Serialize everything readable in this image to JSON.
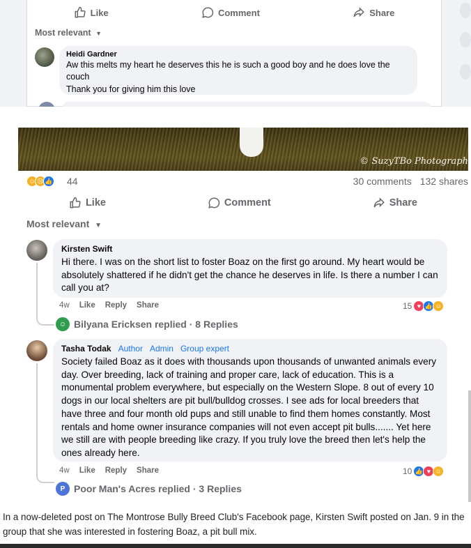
{
  "top_card": {
    "actions": {
      "like": "Like",
      "comment": "Comment",
      "share": "Share"
    },
    "sort_label": "Most relevant",
    "comment": {
      "author": "Heidi Gardner",
      "text": "Aw this melts my heart he deserves this he is such a good boy and he does love the couch",
      "text2": "Thank you for giving him this love"
    }
  },
  "post": {
    "photo_credit": "© SuzyTBo Photograph",
    "reaction_count": "44",
    "comments_count": "30 comments",
    "shares_count": "132 shares",
    "actions": {
      "like": "Like",
      "comment": "Comment",
      "share": "Share"
    },
    "sort_label": "Most relevant"
  },
  "comments": [
    {
      "author": "Kirsten Swift",
      "text": "Hi there. I was on the short list to foster Boaz on the first go around. My heart would be absolutely shattered if he didn't get the chance he deserves in life. Is there a number I can call you at?",
      "time": "4w",
      "like": "Like",
      "reply": "Reply",
      "share": "Share",
      "reactions": "15",
      "replied_by": "Bilyana Ericksen replied · 8 Replies"
    },
    {
      "author": "Tasha Todak",
      "badges": [
        "Author",
        "Admin",
        "Group expert"
      ],
      "text": "Society failed Boaz as it does with thousands upon thousands of unwanted animals every day. Over breeding, lack of training and proper care, lack of education. This is a monumental problem everywhere, but especially on the Western Slope. 8 out of every 10 dogs in our local shelters are pit bull/bulldog crosses. I see ads for local breeders that have three and four month old pups and still unable to find them homes constantly. Most rentals and home owner insurance companies will not even accept pit bulls....... Yet here we still are with people breeding like crazy. If you truly love the breed then let's help the ones already here.",
      "time": "4w",
      "like": "Like",
      "reply": "Reply",
      "share": "Share",
      "reactions": "10",
      "replied_by": "Poor Man's Acres replied · 3 Replies",
      "replied_initial": "P"
    }
  ],
  "caption": "In a now-deleted post on The Montrose Bully Breed Club's Facebook page, Kirsten Swift posted on Jan. 9 in the group that she was interested in fostering Boaz, a pit bull mix.",
  "colors": {
    "facebook_blue": "#1877f2",
    "muted_text": "#65676b",
    "bubble_bg": "#f0f2f5"
  }
}
